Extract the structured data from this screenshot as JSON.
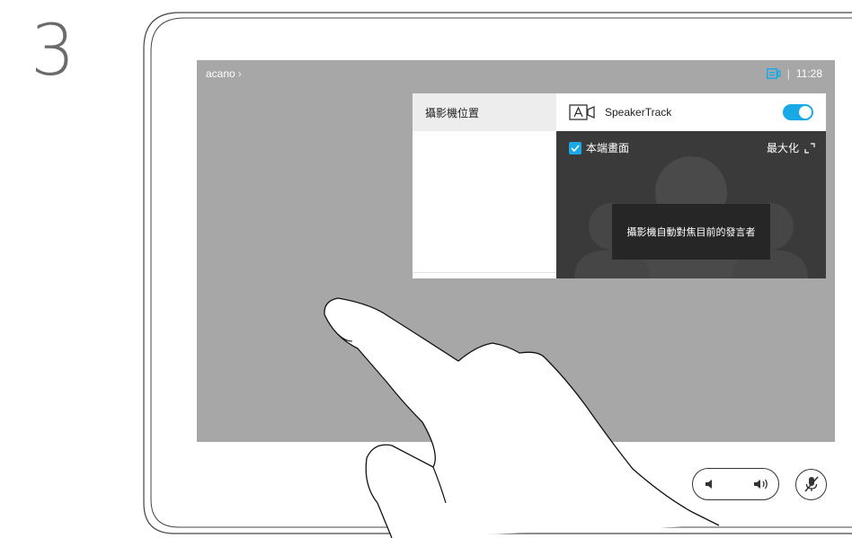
{
  "step": {
    "number": "3"
  },
  "status_bar": {
    "meeting_name": "acano",
    "chevron": "›",
    "separator": "|",
    "time": "11:28",
    "layout_icon": "layout-icon"
  },
  "camera_panel": {
    "left_item_label": "攝影機位置",
    "speakertrack_label": "SpeakerTrack",
    "speakertrack_on": true,
    "self_view_label": "本端畫面",
    "self_view_checked": true,
    "maximize_label": "最大化",
    "tooltip_text": "攝影機自動對焦目前的發言者"
  },
  "colors": {
    "accent": "#18a9e6",
    "screen_bg": "#a7a7a7",
    "preview_bg": "#3a3a3a"
  },
  "controls": {
    "volume_down_icon": "volume-down-icon",
    "volume_up_icon": "volume-up-icon",
    "mute_icon": "microphone-muted-icon"
  }
}
